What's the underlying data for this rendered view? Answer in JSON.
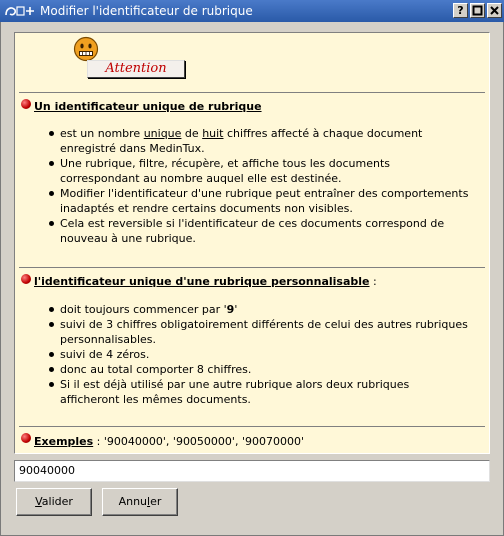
{
  "window": {
    "title": "Modifier l'identificateur de rubrique",
    "help_label": "?",
    "maximize_icon": "maximize-icon",
    "close_icon": "close-icon"
  },
  "attention": {
    "label": "Attention",
    "icon": "smiley-icon"
  },
  "section1": {
    "heading": "Un identificateur unique de rubrique",
    "bullets": {
      "b1": {
        "a": "est un nombre ",
        "b": "unique",
        "c": " de ",
        "d": "huit",
        "e": " chiffres affecté à chaque document",
        "line2": "enregistré dans MedinTux."
      },
      "b2": {
        "line1": "Une rubrique, filtre, récupère, et affiche tous les documents",
        "line2": "correspondant au nombre auquel elle est destinée."
      },
      "b3": {
        "line1": "Modifier l'identificateur d'une rubrique peut entraîner des comportements",
        "line2": "inadaptés et rendre certains documents non visibles."
      },
      "b4": {
        "line1": "Cela est reversible si l'identificateur de ces documents correspond de",
        "line2": "nouveau à une rubrique."
      }
    }
  },
  "section2": {
    "heading": "l'identificateur unique d'une rubrique personnalisable",
    "suffix": " :",
    "bullets": {
      "b1": {
        "a": "doit toujours commencer par '",
        "b": "9",
        "c": "'"
      },
      "b2": {
        "line1": "suivi de 3 chiffres obligatoirement différents de celui des autres rubriques",
        "line2": "personnalisables."
      },
      "b3": {
        "line1": "suivi de 4 zéros."
      },
      "b4": {
        "line1": "donc au total comporter 8 chiffres."
      },
      "b5": {
        "line1": "Si il est déjà utilisé par une autre rubrique alors deux rubriques",
        "line2": "afficheront les mêmes documents."
      }
    }
  },
  "section3": {
    "heading": "Exemples",
    "text": " : '90040000', '90050000', '90070000'"
  },
  "input": {
    "value": "90040000"
  },
  "buttons": {
    "validate": {
      "mnemonic": "V",
      "rest": "alider"
    },
    "cancel": {
      "pre": "Annu",
      "mnemonic": "l",
      "rest": "er"
    }
  }
}
